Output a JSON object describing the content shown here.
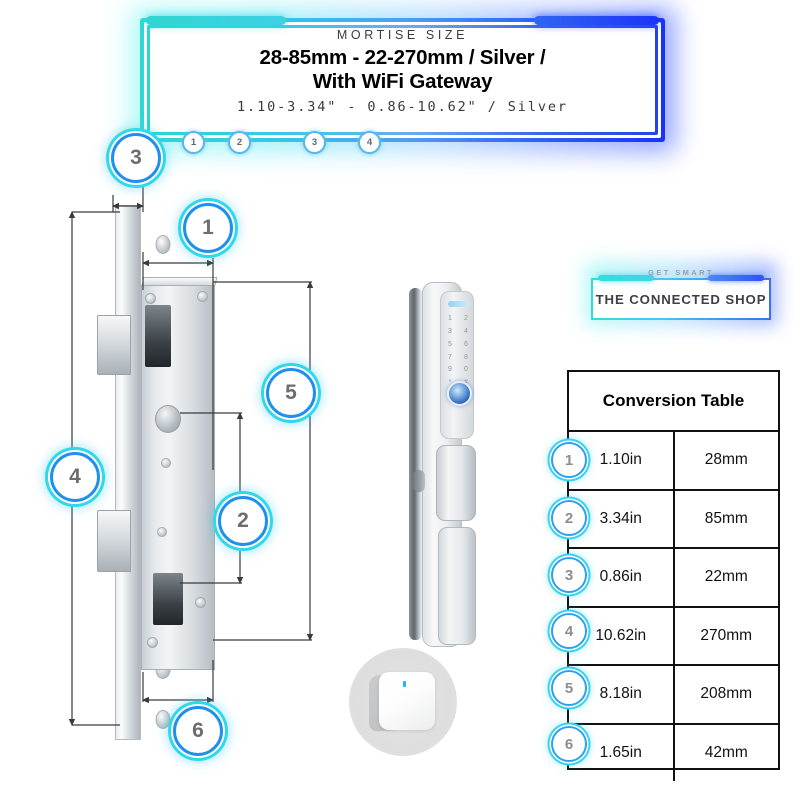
{
  "header": {
    "kicker": "MORTISE SIZE",
    "title_line1": "28-85mm - 22-270mm / Silver /",
    "title_line2": "With WiFi Gateway",
    "subtitle": "1.10-3.34\" - 0.86-10.62\" / Silver",
    "rail_badges": [
      "1",
      "2",
      "3",
      "4"
    ]
  },
  "callouts": [
    {
      "id": "3",
      "label": "3"
    },
    {
      "id": "1",
      "label": "1"
    },
    {
      "id": "5",
      "label": "5"
    },
    {
      "id": "4",
      "label": "4"
    },
    {
      "id": "2",
      "label": "2"
    },
    {
      "id": "6",
      "label": "6"
    }
  ],
  "conversion_table": {
    "title": "Conversion Table",
    "rows": [
      {
        "badge": "1",
        "inches": "1.10in",
        "mm": "28mm"
      },
      {
        "badge": "2",
        "inches": "3.34in",
        "mm": "85mm"
      },
      {
        "badge": "3",
        "inches": "0.86in",
        "mm": "22mm"
      },
      {
        "badge": "4",
        "inches": "10.62in",
        "mm": "270mm"
      },
      {
        "badge": "5",
        "inches": "8.18in",
        "mm": "208mm"
      },
      {
        "badge": "6",
        "inches": "1.65in",
        "mm": "42mm"
      }
    ]
  },
  "logo": {
    "tagline": "GET SMART",
    "name": "THE CONNECTED SHOP"
  },
  "keypad": {
    "keys": [
      "1",
      "2",
      "3",
      "4",
      "5",
      "6",
      "7",
      "8",
      "9",
      "0",
      "*",
      "#"
    ]
  },
  "colors": {
    "accent_cyan": "#2fd9d2",
    "accent_blue": "#1832f7",
    "badge_ring_blue": "#1f90f0",
    "badge_ring_cyan": "#30d8e8",
    "table_border": "#111111",
    "background": "#ffffff",
    "gateway_led": "#1fb8ef"
  }
}
